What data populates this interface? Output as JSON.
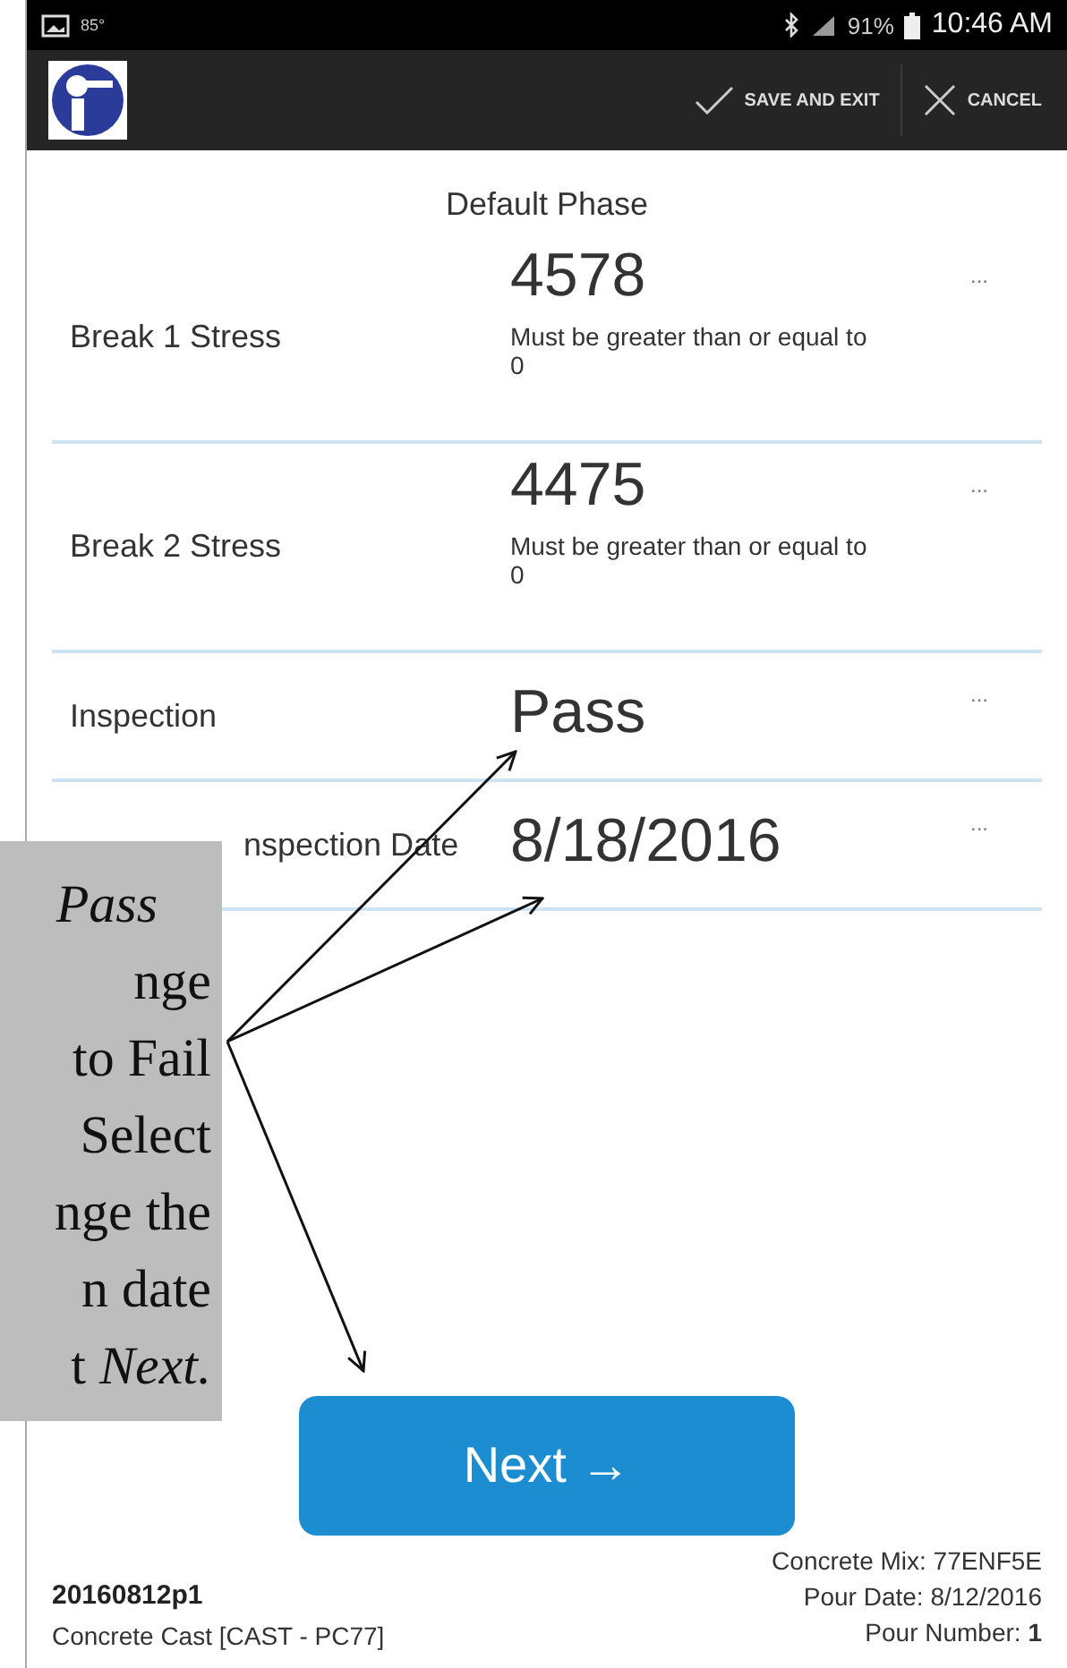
{
  "status_bar": {
    "temperature": "85°",
    "battery": "91%",
    "time": "10:46 AM"
  },
  "app_bar": {
    "actions": [
      {
        "kind": "check",
        "label": "SAVE AND EXIT"
      },
      {
        "kind": "close",
        "label": "CANCEL"
      }
    ]
  },
  "phase": "Default Phase",
  "fields": [
    {
      "label": "Break 1 Stress",
      "value": "4578",
      "hint": "Must be greater than or equal to 0",
      "covered": false,
      "more": "..."
    },
    {
      "label": "Break 2 Stress",
      "value": "4475",
      "hint": "Must be greater than or equal to 0",
      "covered": false,
      "more": "..."
    },
    {
      "label": "Inspection",
      "value": "Pass",
      "covered": false,
      "more": "..."
    },
    {
      "label": "nspection Date",
      "value": "8/18/2016",
      "covered": true,
      "more": "..."
    }
  ],
  "callout": {
    "lines": [
      "*Pass*",
      "nge",
      "to Fail",
      "Select",
      "nge the",
      "n date",
      "t *Next.*"
    ]
  },
  "next_button": "Next →",
  "footer": {
    "id": "20160812p1",
    "cast": "Concrete Cast [CAST - PC77]",
    "details": [
      "Concrete Mix: 77ENF5E",
      "Pour Date: 8/12/2016",
      "Pour Number: **1**"
    ]
  }
}
